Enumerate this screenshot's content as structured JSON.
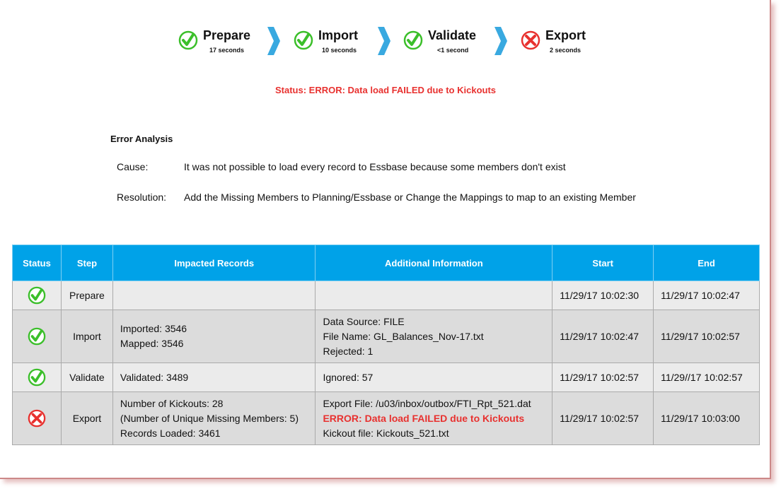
{
  "colors": {
    "ok": "#3bbf2a",
    "error": "#e8312f",
    "header": "#00a2e8",
    "chevron": "#39a9e0"
  },
  "steps": [
    {
      "name": "Prepare",
      "duration": "17 seconds",
      "state": "success",
      "icon": "check-circle-icon"
    },
    {
      "name": "Import",
      "duration": "10 seconds",
      "state": "success",
      "icon": "check-circle-icon"
    },
    {
      "name": "Validate",
      "duration": "<1 second",
      "state": "success",
      "icon": "check-circle-icon"
    },
    {
      "name": "Export",
      "duration": "2 seconds",
      "state": "error",
      "icon": "error-circle-icon"
    }
  ],
  "status": "Status: ERROR: Data load FAILED due to Kickouts",
  "analysis": {
    "title": "Error Analysis",
    "cause_label": "Cause:",
    "cause": "It was not possible to load every record to Essbase because some members don't exist",
    "resolution_label": "Resolution:",
    "resolution": "Add the Missing Members to Planning/Essbase or Change the Mappings to map to an existing Member"
  },
  "table": {
    "headers": [
      "Status",
      "Step",
      "Impacted Records",
      "Additional Information",
      "Start",
      "End"
    ],
    "rows": [
      {
        "status": "success",
        "step": "Prepare",
        "impacted": [],
        "info": [],
        "start": "11/29/17 10:02:30",
        "end": "11/29/17 10:02:47"
      },
      {
        "status": "success",
        "step": "Import",
        "impacted": [
          "Imported: 3546",
          "Mapped: 3546"
        ],
        "info": [
          "Data Source: FILE",
          "File Name: GL_Balances_Nov-17.txt",
          "Rejected: 1"
        ],
        "start": "11/29/17 10:02:47",
        "end": "11/29/17 10:02:57"
      },
      {
        "status": "success",
        "step": "Validate",
        "impacted": [
          "Validated: 3489"
        ],
        "info": [
          "Ignored: 57"
        ],
        "start": "11/29/17 10:02:57",
        "end": "11/29//17 10:02:57"
      },
      {
        "status": "error",
        "step": "Export",
        "impacted": [
          "Number of Kickouts: 28",
          "(Number of Unique Missing Members: 5)",
          "Records Loaded: 3461"
        ],
        "info": [
          "Export File: /u03/inbox/outbox/FTI_Rpt_521.dat",
          "ERROR: Data load FAILED due to Kickouts",
          "Kickout file: Kickouts_521.txt"
        ],
        "start": "11/29/17 10:02:57",
        "end": "11/29/17 10:03:00"
      }
    ]
  }
}
